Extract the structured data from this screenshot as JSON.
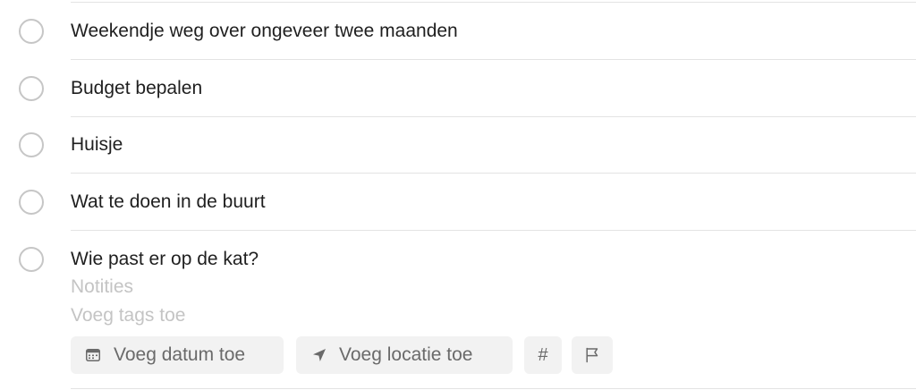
{
  "tasks": [
    {
      "title": "Weekendje weg over ongeveer twee maanden"
    },
    {
      "title": "Budget bepalen"
    },
    {
      "title": "Huisje"
    },
    {
      "title": "Wat te doen in de buurt"
    },
    {
      "title": "Wie past er op de kat?"
    }
  ],
  "editor": {
    "notes_placeholder": "Notities",
    "tags_placeholder": "Voeg tags toe",
    "date_button": {
      "label": "Voeg datum toe",
      "icon": "calendar-icon"
    },
    "location_button": {
      "label": "Voeg locatie toe",
      "icon": "location-arrow-icon"
    },
    "tag_button": {
      "glyph": "#",
      "icon": "hash-icon"
    },
    "flag_button": {
      "icon": "flag-icon"
    }
  },
  "colors": {
    "circle_border": "#c6c6c6",
    "divider": "#e3e3e3",
    "placeholder": "#c4c4c4",
    "chip_bg": "#f2f2f2",
    "chip_text": "#6a6a6a"
  }
}
